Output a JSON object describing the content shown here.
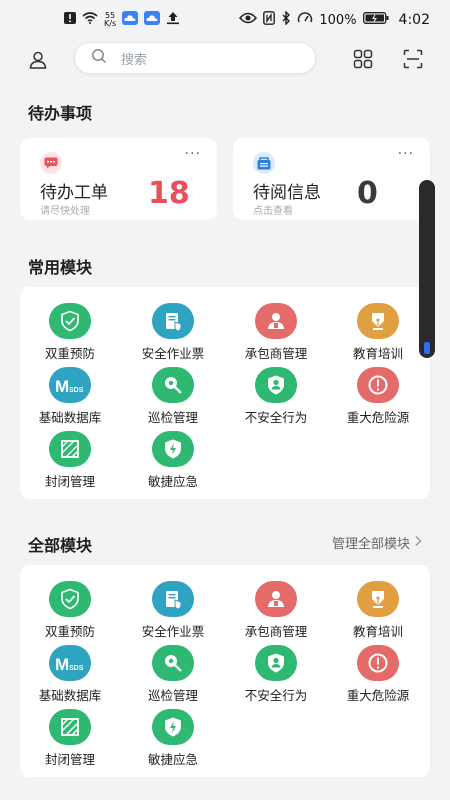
{
  "status_bar": {
    "net_speed_value": "55",
    "net_speed_unit": "K/s",
    "battery_text": "100%",
    "time": "4:02"
  },
  "search": {
    "placeholder": "搜索"
  },
  "pending": {
    "title": "待办事项",
    "cards": [
      {
        "title": "待办工单",
        "subtitle": "请尽快处理",
        "count": "18",
        "more": "···",
        "icon": "message-icon",
        "accent": "#e8505b"
      },
      {
        "title": "待阅信息",
        "subtitle": "点击查看",
        "count": "0",
        "more": "···",
        "icon": "doc-icon",
        "accent": "#3b3b3b"
      }
    ]
  },
  "common_modules": {
    "title": "常用模块",
    "items": [
      {
        "label": "双重预防",
        "icon": "shield-check-icon",
        "color": "#2eb872"
      },
      {
        "label": "安全作业票",
        "icon": "ticket-icon",
        "color": "#2fa3c2"
      },
      {
        "label": "承包商管理",
        "icon": "contractor-icon",
        "color": "#e56a6a"
      },
      {
        "label": "教育培训",
        "icon": "pen-icon",
        "color": "#e0a042"
      },
      {
        "label": "基础数据库",
        "icon": "msds-icon",
        "color": "#2fa3c2"
      },
      {
        "label": "巡检管理",
        "icon": "inspection-icon",
        "color": "#2eb872"
      },
      {
        "label": "不安全行为",
        "icon": "person-shield-icon",
        "color": "#2eb872"
      },
      {
        "label": "重大危险源",
        "icon": "alert-icon",
        "color": "#e56a6a"
      },
      {
        "label": "封闭管理",
        "icon": "closed-area-icon",
        "color": "#2eb872"
      },
      {
        "label": "敏捷应急",
        "icon": "emergency-icon",
        "color": "#2eb872"
      }
    ]
  },
  "all_modules": {
    "title": "全部模块",
    "manage_link": "管理全部模块",
    "items": [
      {
        "label": "双重预防",
        "icon": "shield-check-icon",
        "color": "#2eb872"
      },
      {
        "label": "安全作业票",
        "icon": "ticket-icon",
        "color": "#2fa3c2"
      },
      {
        "label": "承包商管理",
        "icon": "contractor-icon",
        "color": "#e56a6a"
      },
      {
        "label": "教育培训",
        "icon": "pen-icon",
        "color": "#e0a042"
      },
      {
        "label": "基础数据库",
        "icon": "msds-icon",
        "color": "#2fa3c2"
      },
      {
        "label": "巡检管理",
        "icon": "inspection-icon",
        "color": "#2eb872"
      },
      {
        "label": "不安全行为",
        "icon": "person-shield-icon",
        "color": "#2eb872"
      },
      {
        "label": "重大危险源",
        "icon": "alert-icon",
        "color": "#e56a6a"
      },
      {
        "label": "封闭管理",
        "icon": "closed-area-icon",
        "color": "#2eb872"
      },
      {
        "label": "敏捷应急",
        "icon": "emergency-icon",
        "color": "#2eb872"
      }
    ]
  },
  "msds_text": "MSDS"
}
